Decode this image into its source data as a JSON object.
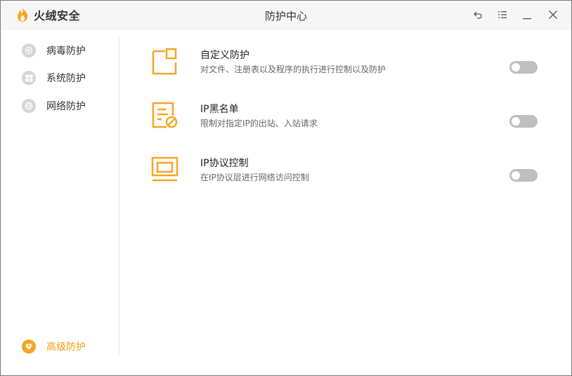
{
  "app": {
    "brand": "火绒安全",
    "title": "防护中心",
    "accent_color": "#f5a623"
  },
  "window_controls": [
    {
      "name": "back-icon"
    },
    {
      "name": "menu-icon"
    },
    {
      "name": "minimize-icon"
    },
    {
      "name": "close-icon"
    }
  ],
  "sidebar": {
    "items": [
      {
        "label": "病毒防护",
        "icon": "virus-shield-icon",
        "active": false
      },
      {
        "label": "系统防护",
        "icon": "windows-icon",
        "active": false
      },
      {
        "label": "网络防护",
        "icon": "globe-icon",
        "active": false
      }
    ],
    "bottom_item": {
      "label": "高级防护",
      "icon": "diamond-icon",
      "active": true
    }
  },
  "features": [
    {
      "title": "自定义防护",
      "description": "对文件、注册表以及程序的执行进行控制以及防护",
      "icon": "custom-protection-icon",
      "enabled": false
    },
    {
      "title": "IP黑名单",
      "description": "限制对指定IP的出站、入站请求",
      "icon": "ip-blacklist-icon",
      "enabled": false
    },
    {
      "title": "IP协议控制",
      "description": "在IP协议层进行网络访问控制",
      "icon": "ip-protocol-icon",
      "enabled": false
    }
  ]
}
